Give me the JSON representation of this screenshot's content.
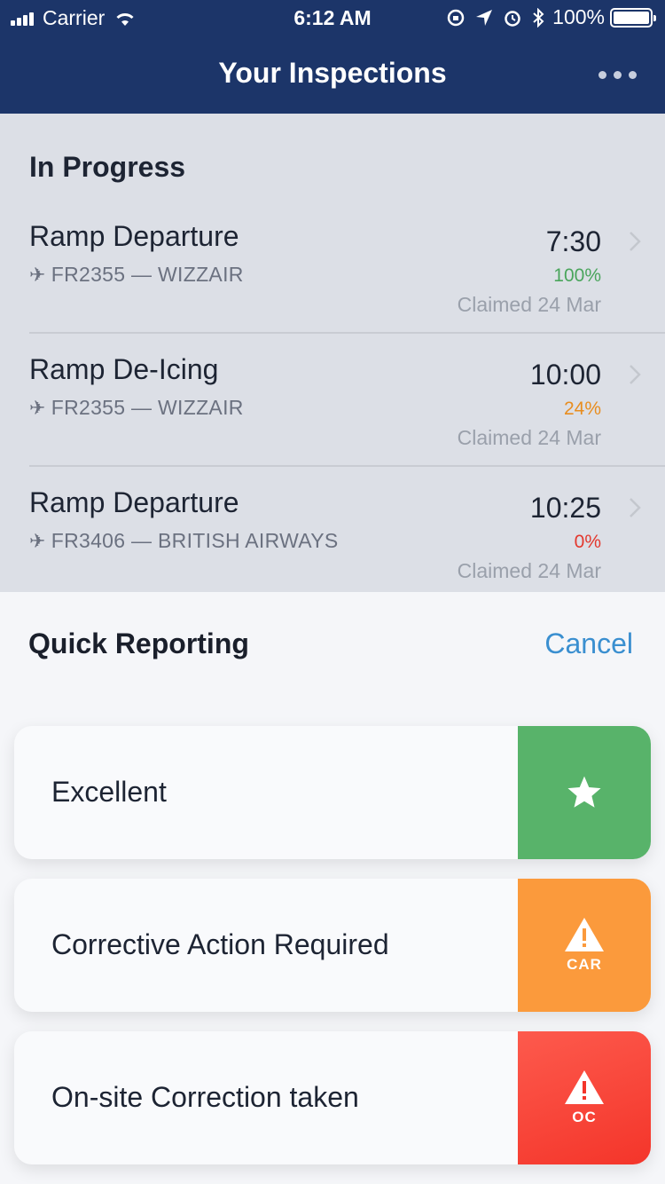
{
  "status_bar": {
    "carrier": "Carrier",
    "time": "6:12 AM",
    "battery": "100%"
  },
  "nav": {
    "title": "Your Inspections",
    "more_icon": "ellipsis-icon"
  },
  "in_progress": {
    "title": "In Progress",
    "items": [
      {
        "name": "Ramp Departure",
        "flight": "FR2355 — WIZZAIR",
        "time": "7:30",
        "progress": "100%",
        "progress_color": "#4aa55c",
        "claimed": "Claimed 24 Mar"
      },
      {
        "name": "Ramp De-Icing",
        "flight": "FR2355 — WIZZAIR",
        "time": "10:00",
        "progress": "24%",
        "progress_color": "#e88d1f",
        "claimed": "Claimed 24 Mar"
      },
      {
        "name": "Ramp Departure",
        "flight": "FR3406 — BRITISH AIRWAYS",
        "time": "10:25",
        "progress": "0%",
        "progress_color": "#e3382e",
        "claimed": "Claimed 24 Mar"
      }
    ]
  },
  "quick_reporting": {
    "title": "Quick Reporting",
    "cancel_label": "Cancel",
    "options": [
      {
        "label": "Excellent",
        "icon": "star-icon",
        "code": "",
        "color": "#58b36a"
      },
      {
        "label": "Corrective Action Required",
        "icon": "warning-icon",
        "code": "CAR",
        "color": "#fb9a3c"
      },
      {
        "label": "On-site Correction taken",
        "icon": "warning-icon",
        "code": "OC",
        "color": "#f4352a"
      }
    ]
  }
}
